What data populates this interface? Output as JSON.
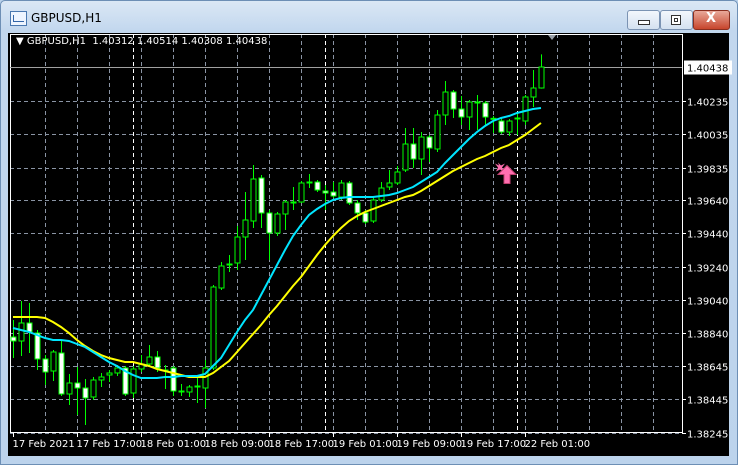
{
  "window": {
    "title": "GBPUSD,H1",
    "buttons": {
      "minimize": "minimize",
      "maximize": "maximize",
      "close": "X"
    }
  },
  "chart_legend": {
    "marker": "▼",
    "symbol": "GBPUSD,H1",
    "open": "1.40312",
    "high": "1.40514",
    "low": "1.40308",
    "close": "1.40438"
  },
  "colors": {
    "background": "#000000",
    "candle": "#00ff00",
    "bear_body": "#ffffff",
    "bull_body": "#000000",
    "ma_fast": "#00e5ff",
    "ma_slow": "#ffff00",
    "signal_arrow": "#ff6fb0",
    "grid": "#8a94a4"
  },
  "chart_data": {
    "type": "candlestick",
    "symbol": "GBPUSD",
    "timeframe": "H1",
    "current_price": 1.40438,
    "y_ticks": [
      "1.40235",
      "1.40035",
      "1.39835",
      "1.39640",
      "1.39440",
      "1.39240",
      "1.39040",
      "1.38840",
      "1.38645",
      "1.38445",
      "1.38245"
    ],
    "ylim": [
      1.38245,
      1.40438
    ],
    "grid": true,
    "x_ticks": [
      {
        "bar": 0,
        "label": "17 Feb 2021"
      },
      {
        "bar": 8,
        "label": "17 Feb 17:00"
      },
      {
        "bar": 16,
        "label": "18 Feb 01:00"
      },
      {
        "bar": 24,
        "label": "18 Feb 09:00"
      },
      {
        "bar": 32,
        "label": "18 Feb 17:00"
      },
      {
        "bar": 40,
        "label": "19 Feb 01:00"
      },
      {
        "bar": 48,
        "label": "19 Feb 09:00"
      },
      {
        "bar": 56,
        "label": "19 Feb 17:00"
      },
      {
        "bar": 64,
        "label": "22 Feb 01:00"
      }
    ],
    "day_separators_at_bars": [
      15,
      39,
      63
    ],
    "ohlc": [
      [
        1.38818,
        1.3892,
        1.38692,
        1.38794
      ],
      [
        1.38794,
        1.39034,
        1.38704,
        1.38902
      ],
      [
        1.38902,
        1.39022,
        1.38722,
        1.38848
      ],
      [
        1.38842,
        1.3886,
        1.3862,
        1.38686
      ],
      [
        1.38686,
        1.3871,
        1.3853,
        1.38608
      ],
      [
        1.38614,
        1.3874,
        1.38554,
        1.38728
      ],
      [
        1.38722,
        1.388,
        1.38464,
        1.38476
      ],
      [
        1.38476,
        1.38596,
        1.3841,
        1.38542
      ],
      [
        1.38542,
        1.38638,
        1.3835,
        1.38512
      ],
      [
        1.38512,
        1.38566,
        1.3829,
        1.38452
      ],
      [
        1.38458,
        1.38578,
        1.3844,
        1.3856
      ],
      [
        1.3856,
        1.38602,
        1.38518,
        1.38578
      ],
      [
        1.3859,
        1.3862,
        1.38548,
        1.38602
      ],
      [
        1.38602,
        1.3865,
        1.38584,
        1.38632
      ],
      [
        1.38632,
        1.38644,
        1.38464,
        1.38476
      ],
      [
        1.38482,
        1.38644,
        1.38452,
        1.38626
      ],
      [
        1.38626,
        1.3871,
        1.38608,
        1.38656
      ],
      [
        1.38656,
        1.3877,
        1.38644,
        1.38698
      ],
      [
        1.38698,
        1.38734,
        1.38608,
        1.38632
      ],
      [
        1.38614,
        1.3865,
        1.38506,
        1.3862
      ],
      [
        1.38632,
        1.38644,
        1.38464,
        1.38494
      ],
      [
        1.38488,
        1.38536,
        1.38464,
        1.38494
      ],
      [
        1.38488,
        1.3853,
        1.38458,
        1.38518
      ],
      [
        1.38524,
        1.38572,
        1.38422,
        1.38518
      ],
      [
        1.38512,
        1.3868,
        1.38392,
        1.38632
      ],
      [
        1.38632,
        1.3913,
        1.3862,
        1.39118
      ],
      [
        1.39112,
        1.39268,
        1.391,
        1.39244
      ],
      [
        1.3925,
        1.3931,
        1.39208,
        1.39256
      ],
      [
        1.39262,
        1.39484,
        1.3922,
        1.39418
      ],
      [
        1.39418,
        1.39688,
        1.3928,
        1.3952
      ],
      [
        1.39514,
        1.3985,
        1.39472,
        1.39766
      ],
      [
        1.39772,
        1.3979,
        1.39472,
        1.39562
      ],
      [
        1.39562,
        1.3958,
        1.3928,
        1.39442
      ],
      [
        1.39442,
        1.39568,
        1.39424,
        1.39556
      ],
      [
        1.39556,
        1.3964,
        1.3946,
        1.39628
      ],
      [
        1.39622,
        1.39718,
        1.3958,
        1.39628
      ],
      [
        1.39628,
        1.39754,
        1.39622,
        1.39742
      ],
      [
        1.39742,
        1.39796,
        1.39712,
        1.39748
      ],
      [
        1.39748,
        1.3976,
        1.39688,
        1.397
      ],
      [
        1.39694,
        1.3973,
        1.3958,
        1.39682
      ],
      [
        1.39688,
        1.39748,
        1.39652,
        1.39664
      ],
      [
        1.39658,
        1.3976,
        1.3964,
        1.39742
      ],
      [
        1.39742,
        1.39754,
        1.3961,
        1.39622
      ],
      [
        1.39622,
        1.3964,
        1.3952,
        1.39562
      ],
      [
        1.39562,
        1.3958,
        1.39496,
        1.39508
      ],
      [
        1.39514,
        1.39658,
        1.39502,
        1.3964
      ],
      [
        1.3964,
        1.39748,
        1.39628,
        1.39712
      ],
      [
        1.39718,
        1.3982,
        1.397,
        1.39742
      ],
      [
        1.39742,
        1.39844,
        1.3973,
        1.39808
      ],
      [
        1.3982,
        1.40072,
        1.39808,
        1.39976
      ],
      [
        1.39976,
        1.40072,
        1.39832,
        1.39886
      ],
      [
        1.39886,
        1.40048,
        1.3979,
        1.40018
      ],
      [
        1.40018,
        1.4003,
        1.39868,
        1.39952
      ],
      [
        1.39946,
        1.4018,
        1.39928,
        1.4015
      ],
      [
        1.4015,
        1.40354,
        1.4009,
        1.40288
      ],
      [
        1.40288,
        1.403,
        1.40132,
        1.40186
      ],
      [
        1.40186,
        1.40264,
        1.4009,
        1.40138
      ],
      [
        1.40138,
        1.4024,
        1.4006,
        1.40228
      ],
      [
        1.40222,
        1.4027,
        1.4006,
        1.40228
      ],
      [
        1.40222,
        1.40234,
        1.4009,
        1.40138
      ],
      [
        1.40126,
        1.40144,
        1.40042,
        1.4013
      ],
      [
        1.40114,
        1.40132,
        1.40036,
        1.40048
      ],
      [
        1.40048,
        1.40126,
        1.40024,
        1.40114
      ],
      [
        1.40126,
        1.40168,
        1.4003,
        1.40132
      ],
      [
        1.40114,
        1.4027,
        1.4009,
        1.40258
      ],
      [
        1.40258,
        1.4042,
        1.40198,
        1.40312
      ],
      [
        1.40312,
        1.40514,
        1.40308,
        1.40438
      ]
    ],
    "ma_fast": [
      1.38872,
      1.3886,
      1.38848,
      1.3883,
      1.38812,
      1.388,
      1.388,
      1.38794,
      1.38776,
      1.38758,
      1.38728,
      1.38698,
      1.38668,
      1.38644,
      1.38614,
      1.3859,
      1.38572,
      1.38572,
      1.38572,
      1.38578,
      1.38578,
      1.38584,
      1.38584,
      1.38584,
      1.38596,
      1.38644,
      1.38692,
      1.3877,
      1.38848,
      1.3892,
      1.3898,
      1.3907,
      1.3916,
      1.3925,
      1.3934,
      1.39424,
      1.3949,
      1.3955,
      1.39586,
      1.39616,
      1.3964,
      1.39652,
      1.39658,
      1.39658,
      1.39658,
      1.39658,
      1.39664,
      1.3967,
      1.39682,
      1.397,
      1.39718,
      1.39748,
      1.39778,
      1.39808,
      1.39862,
      1.3991,
      1.39958,
      1.40006,
      1.40048,
      1.40084,
      1.40114,
      1.40132,
      1.40144,
      1.40162,
      1.40174,
      1.40186,
      1.40192
    ],
    "ma_slow": [
      1.38938,
      1.38938,
      1.38938,
      1.38938,
      1.38932,
      1.38908,
      1.38878,
      1.38842,
      1.388,
      1.38764,
      1.38734,
      1.3871,
      1.38692,
      1.3868,
      1.38668,
      1.38668,
      1.38656,
      1.38644,
      1.38626,
      1.38614,
      1.38602,
      1.3859,
      1.38578,
      1.38578,
      1.38578,
      1.38602,
      1.38638,
      1.38674,
      1.38728,
      1.38782,
      1.38836,
      1.3889,
      1.3895,
      1.39004,
      1.39064,
      1.39124,
      1.39178,
      1.39244,
      1.3931,
      1.3937,
      1.39424,
      1.39472,
      1.39514,
      1.39544,
      1.39568,
      1.39586,
      1.39604,
      1.39622,
      1.3964,
      1.39658,
      1.3967,
      1.39694,
      1.39724,
      1.39754,
      1.39784,
      1.39814,
      1.39838,
      1.39862,
      1.39886,
      1.39904,
      1.39928,
      1.39952,
      1.3997,
      1.4,
      1.4003,
      1.40066,
      1.40102
    ],
    "signals": [
      {
        "bar": 61,
        "type": "buy-arrow",
        "price": 1.39835
      }
    ]
  }
}
